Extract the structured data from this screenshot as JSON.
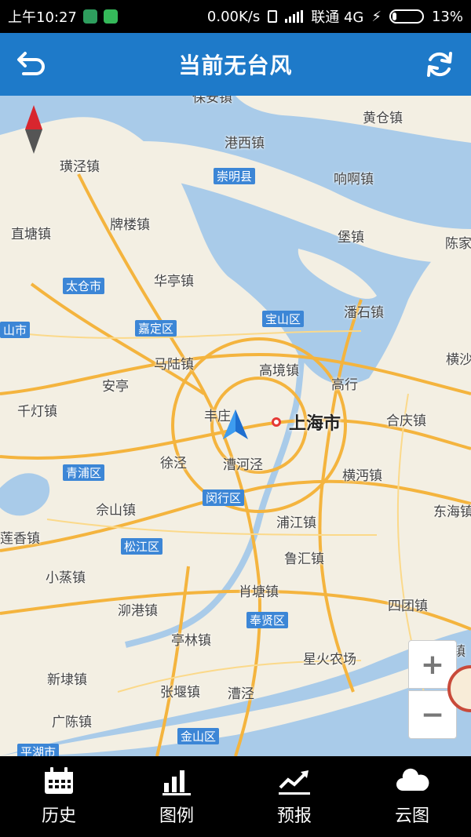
{
  "status": {
    "time": "上午10:27",
    "speed": "0.00K/s",
    "carrier": "联通 4G",
    "battery": "13%",
    "battery_level": 0.13
  },
  "header": {
    "title": "当前无台风"
  },
  "map": {
    "city": "上海市",
    "labels": [
      {
        "id": "baoan",
        "text": "保安镇"
      },
      {
        "id": "huangcang",
        "text": "黄仓镇"
      },
      {
        "id": "gangxi",
        "text": "港西镇"
      },
      {
        "id": "huangjing",
        "text": "璜泾镇"
      },
      {
        "id": "xiangkan",
        "text": "响啊镇"
      },
      {
        "id": "bailou",
        "text": "牌楼镇"
      },
      {
        "id": "zhitang",
        "text": "直塘镇"
      },
      {
        "id": "bao",
        "text": "堡镇"
      },
      {
        "id": "chenjia",
        "text": "陈家"
      },
      {
        "id": "huating",
        "text": "华亭镇"
      },
      {
        "id": "panshi",
        "text": "潘石镇"
      },
      {
        "id": "heng",
        "text": "横沙"
      },
      {
        "id": "malu",
        "text": "马陆镇"
      },
      {
        "id": "gaojing",
        "text": "高境镇"
      },
      {
        "id": "anting",
        "text": "安亭"
      },
      {
        "id": "gaohang",
        "text": "高行"
      },
      {
        "id": "qiandeng",
        "text": "千灯镇"
      },
      {
        "id": "fengzhuang",
        "text": "丰庄"
      },
      {
        "id": "heqing",
        "text": "合庆镇"
      },
      {
        "id": "xujing",
        "text": "徐泾"
      },
      {
        "id": "caohejing",
        "text": "漕河泾"
      },
      {
        "id": "hengmian",
        "text": "横沔镇"
      },
      {
        "id": "sheshan",
        "text": "佘山镇"
      },
      {
        "id": "pujiang",
        "text": "浦江镇"
      },
      {
        "id": "donghai",
        "text": "东海镇"
      },
      {
        "id": "lianxiang",
        "text": "莲香镇"
      },
      {
        "id": "luhui",
        "text": "鲁汇镇"
      },
      {
        "id": "xiaozheng",
        "text": "小蒸镇"
      },
      {
        "id": "xiaotang",
        "text": "肖塘镇"
      },
      {
        "id": "sigang",
        "text": "泖港镇"
      },
      {
        "id": "situan",
        "text": "四团镇"
      },
      {
        "id": "tinglin",
        "text": "亭林镇"
      },
      {
        "id": "luchao",
        "text": "芦潮镇"
      },
      {
        "id": "xinghuo",
        "text": "星火农场"
      },
      {
        "id": "xindai",
        "text": "新埭镇"
      },
      {
        "id": "zhangyan",
        "text": "张堰镇"
      },
      {
        "id": "caojing",
        "text": "漕泾"
      },
      {
        "id": "guangchen",
        "text": "广陈镇"
      }
    ],
    "districts": [
      {
        "id": "chongming",
        "text": "崇明县"
      },
      {
        "id": "taicang",
        "text": "太仓市"
      },
      {
        "id": "kunshan",
        "text": "山市"
      },
      {
        "id": "jiading",
        "text": "嘉定区"
      },
      {
        "id": "baoshan",
        "text": "宝山区"
      },
      {
        "id": "qingpu",
        "text": "青浦区"
      },
      {
        "id": "minhang",
        "text": "闵行区"
      },
      {
        "id": "songjiang",
        "text": "松江区"
      },
      {
        "id": "fengxian",
        "text": "奉贤区"
      },
      {
        "id": "jinshan",
        "text": "金山区"
      },
      {
        "id": "pinghu",
        "text": "平湖市"
      }
    ],
    "zoom_in": "+",
    "zoom_out": "−"
  },
  "nav": [
    {
      "id": "history",
      "label": "历史",
      "icon": "calendar-icon"
    },
    {
      "id": "legend",
      "label": "图例",
      "icon": "bar-chart-icon"
    },
    {
      "id": "forecast",
      "label": "预报",
      "icon": "trend-line-icon"
    },
    {
      "id": "cloud",
      "label": "云图",
      "icon": "cloud-icon"
    }
  ]
}
